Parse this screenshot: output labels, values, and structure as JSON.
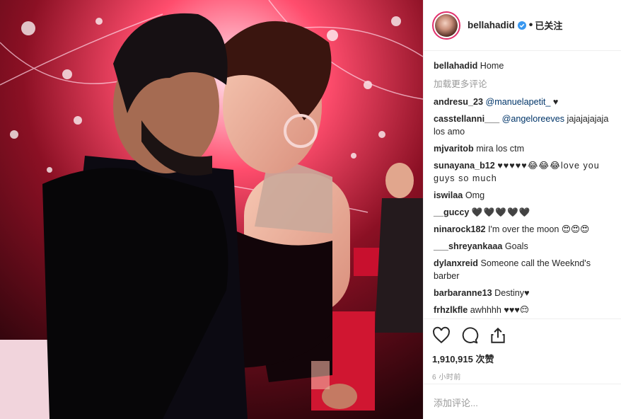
{
  "header": {
    "username": "bellahadid",
    "separator": "•",
    "follow_label": "已关注"
  },
  "caption": {
    "username": "bellahadid",
    "text": "Home"
  },
  "load_more": "加载更多评论",
  "comments": [
    {
      "user": "andresu_23",
      "mention": "@manuelapetit_",
      "text": " ♥"
    },
    {
      "user": "casstellanni___",
      "mention": "@angeloreeves",
      "text": " jajajajajaja los amo"
    },
    {
      "user": "mjvaritob",
      "mention": "",
      "text": "mira los ctm"
    },
    {
      "user": "sunayana_b12",
      "mention": "",
      "text": "♥♥♥♥♥😂😂😂love you guys so much"
    },
    {
      "user": "iswilaa",
      "mention": "",
      "text": "Omg"
    },
    {
      "user": "__guccy",
      "mention": "",
      "text": "🖤🖤🖤🖤🖤"
    },
    {
      "user": "ninarock182",
      "mention": "",
      "text": "I'm over the moon 😍😍😍"
    },
    {
      "user": "___shreyankaaa",
      "mention": "",
      "text": "Goals"
    },
    {
      "user": "dylanxreid",
      "mention": "",
      "text": "Someone call the Weeknd's barber"
    },
    {
      "user": "barbaranne13",
      "mention": "",
      "text": "Destiny♥"
    },
    {
      "user": "frhzlkfle",
      "mention": "",
      "text": "awhhhh ♥♥♥😌"
    }
  ],
  "likes": {
    "count": "1,910,915",
    "label": "次赞"
  },
  "time": "6 小时前",
  "add_comment_placeholder": "添加评论...",
  "icons": [
    "heart-icon",
    "comment-icon",
    "share-icon",
    "verified-badge-icon"
  ]
}
